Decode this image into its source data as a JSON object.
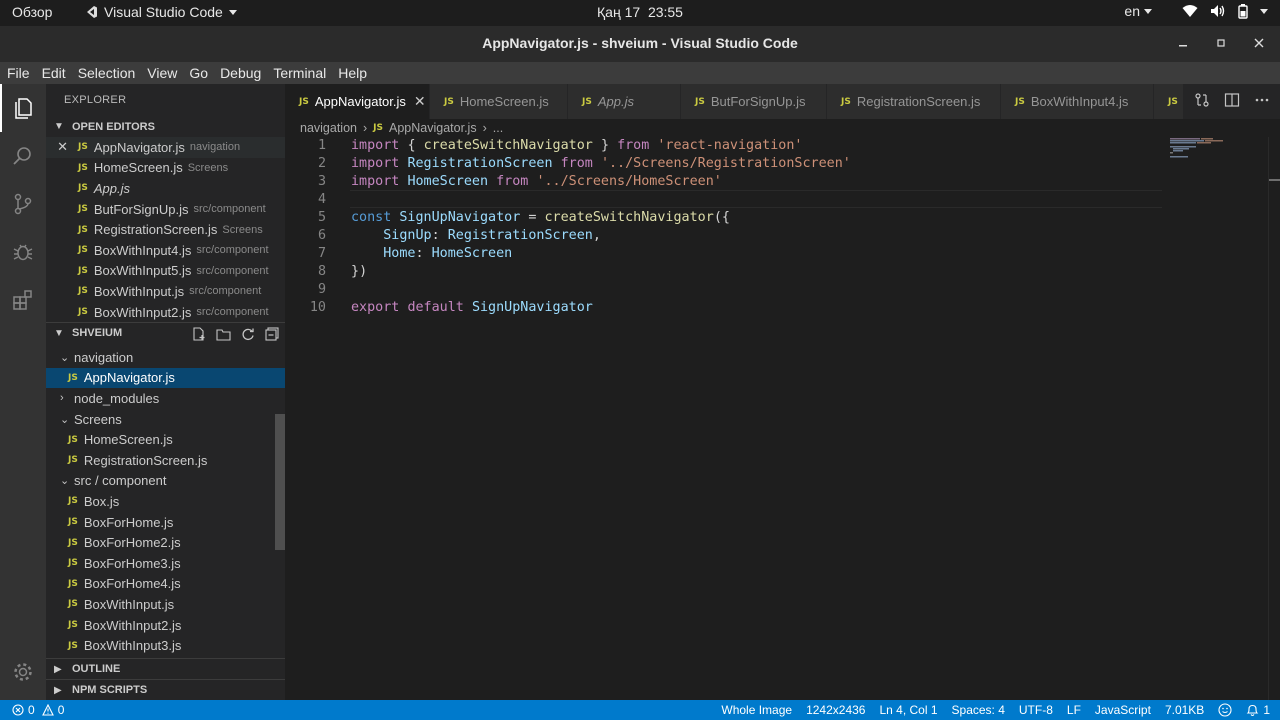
{
  "topbar": {
    "activities": "Обзор",
    "app_name": "Visual Studio Code",
    "date": "Қаң 17",
    "time": "23:55",
    "language": "en"
  },
  "window": {
    "title": "AppNavigator.js - shveium - Visual Studio Code"
  },
  "menu": [
    "File",
    "Edit",
    "Selection",
    "View",
    "Go",
    "Debug",
    "Terminal",
    "Help"
  ],
  "sidebar": {
    "title": "EXPLORER",
    "open_editors": {
      "header": "OPEN EDITORS",
      "items": [
        {
          "icon": "JS",
          "name": "AppNavigator.js",
          "desc": "navigation"
        },
        {
          "icon": "JS",
          "name": "HomeScreen.js",
          "desc": "Screens"
        },
        {
          "icon": "JS",
          "name": "App.js",
          "desc": ""
        },
        {
          "icon": "JS",
          "name": "ButForSignUp.js",
          "desc": "src/component"
        },
        {
          "icon": "JS",
          "name": "RegistrationScreen.js",
          "desc": "Screens"
        },
        {
          "icon": "JS",
          "name": "BoxWithInput4.js",
          "desc": "src/component"
        },
        {
          "icon": "JS",
          "name": "BoxWithInput5.js",
          "desc": "src/component"
        },
        {
          "icon": "JS",
          "name": "BoxWithInput.js",
          "desc": "src/component"
        },
        {
          "icon": "JS",
          "name": "BoxWithInput2.js",
          "desc": "src/component"
        }
      ]
    },
    "project": {
      "header": "SHVEIUM",
      "tree": [
        {
          "type": "folder",
          "name": "navigation",
          "expanded": true
        },
        {
          "type": "file",
          "icon": "JS",
          "name": "AppNavigator.js",
          "selected": true
        },
        {
          "type": "folder",
          "name": "node_modules",
          "expanded": false
        },
        {
          "type": "folder",
          "name": "Screens",
          "expanded": true
        },
        {
          "type": "file",
          "icon": "JS",
          "name": "HomeScreen.js"
        },
        {
          "type": "file",
          "icon": "JS",
          "name": "RegistrationScreen.js"
        },
        {
          "type": "folder",
          "name": "src / component",
          "expanded": true
        },
        {
          "type": "file",
          "icon": "JS",
          "name": "Box.js"
        },
        {
          "type": "file",
          "icon": "JS",
          "name": "BoxForHome.js"
        },
        {
          "type": "file",
          "icon": "JS",
          "name": "BoxForHome2.js"
        },
        {
          "type": "file",
          "icon": "JS",
          "name": "BoxForHome3.js"
        },
        {
          "type": "file",
          "icon": "JS",
          "name": "BoxForHome4.js"
        },
        {
          "type": "file",
          "icon": "JS",
          "name": "BoxWithInput.js"
        },
        {
          "type": "file",
          "icon": "JS",
          "name": "BoxWithInput2.js"
        },
        {
          "type": "file",
          "icon": "JS",
          "name": "BoxWithInput3.js"
        }
      ]
    },
    "outline": "OUTLINE",
    "npm_scripts": "NPM SCRIPTS"
  },
  "tabs": [
    {
      "icon": "JS",
      "name": "AppNavigator.js",
      "active": true
    },
    {
      "icon": "JS",
      "name": "HomeScreen.js"
    },
    {
      "icon": "JS",
      "name": "App.js",
      "italic": true
    },
    {
      "icon": "JS",
      "name": "ButForSignUp.js"
    },
    {
      "icon": "JS",
      "name": "RegistrationScreen.js"
    },
    {
      "icon": "JS",
      "name": "BoxWithInput4.js"
    },
    {
      "icon": "JS",
      "name": ""
    }
  ],
  "breadcrumb": [
    "navigation",
    "AppNavigator.js",
    "..."
  ],
  "code": {
    "line_numbers": [
      "1",
      "2",
      "3",
      "4",
      "5",
      "6",
      "7",
      "8",
      "9",
      "10"
    ],
    "lines": [
      "import { createSwitchNavigator } from 'react-navigation'",
      "import RegistrationScreen from '../Screens/RegistrationScreen'",
      "import HomeScreen from '../Screens/HomeScreen'",
      "",
      "const SignUpNavigator = createSwitchNavigator({",
      "    SignUp: RegistrationScreen,",
      "    Home: HomeScreen",
      "})",
      "",
      "export default SignUpNavigator"
    ]
  },
  "statusbar": {
    "errors": "0",
    "warnings": "0",
    "items": [
      "Whole Image",
      "1242x2436",
      "Ln 4, Col 1",
      "Spaces: 4",
      "UTF-8",
      "LF",
      "JavaScript",
      "7.01KB"
    ],
    "notifications": "1"
  },
  "colors": {
    "accent": "#007acc",
    "selection": "#094771",
    "js_icon": "#cbcb41"
  }
}
